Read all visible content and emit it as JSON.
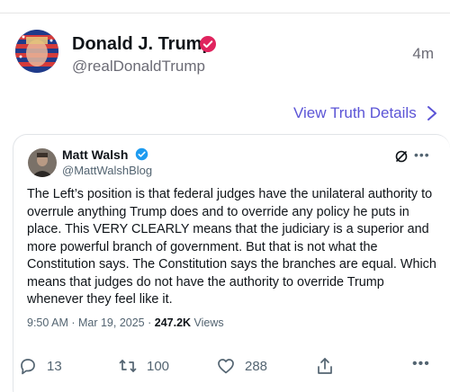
{
  "post": {
    "author_name": "Donald J. Trump",
    "author_handle": "@realDonaldTrump",
    "time_ago": "4m",
    "view_details_label": "View Truth Details"
  },
  "embed": {
    "author_name": "Matt Walsh",
    "author_handle": "@MattWalshBlog",
    "body": "The Left’s position is that federal judges have the unilateral authority to overrule anything Trump does and to override any policy he puts in place. This VERY CLEARLY means that the judiciary is a superior and more powerful branch of government. But that is not what the Constitution says. The Constitution says the branches are equal. Which means that judges do not have the authority to override Trump whenever they feel like it.",
    "timestamp": "9:50 AM · Mar 19, 2025 · ",
    "views_count": "247.2K",
    "views_label": " Views"
  },
  "actions": {
    "replies": "13",
    "reposts": "100",
    "likes": "288"
  },
  "colors": {
    "accent": "#5b54d6",
    "verified": "#1d9bf0",
    "muted": "#6b6b75"
  }
}
